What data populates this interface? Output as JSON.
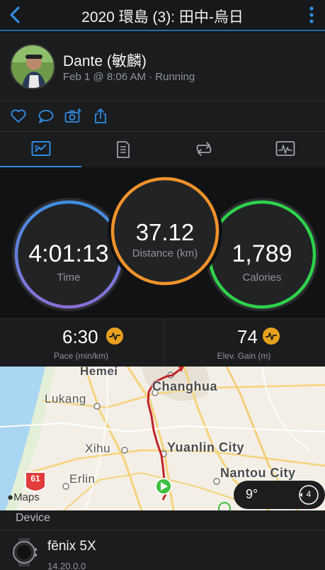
{
  "topbar": {
    "title": "2020 環島 (3): 田中-烏日"
  },
  "activity": {
    "user_name": "Dante (敏麟)",
    "meta": "Feb 1 @ 8:06 AM · Running"
  },
  "actions": [
    "heart-icon",
    "comment-icon",
    "camera-icon",
    "share-icon"
  ],
  "tabs": [
    {
      "icon": "stats-icon",
      "active": true
    },
    {
      "icon": "laps-icon",
      "active": false
    },
    {
      "icon": "repeat-icon",
      "active": false
    },
    {
      "icon": "charts-icon",
      "active": false
    }
  ],
  "stats": {
    "time": {
      "value": "4:01:13",
      "label": "Time"
    },
    "distance": {
      "value": "37.12",
      "label": "Distance (km)"
    },
    "calories": {
      "value": "1,789",
      "label": "Calories"
    }
  },
  "secondary": {
    "pace": {
      "value": "6:30",
      "label": "Pace (min/km)"
    },
    "elevation": {
      "value": "74",
      "label": "Elev. Gain (m)"
    }
  },
  "map": {
    "places": {
      "hemei": "Hemei",
      "changhua": "Changhua",
      "lukang": "Lukang",
      "xihu": "Xihu",
      "yuanlin": "Yuanlin City",
      "erlin": "Erlin",
      "nantou": "Nantou City"
    },
    "highway": "61",
    "attribution": "Maps",
    "weather_temp": "9°",
    "wind": "4"
  },
  "device": {
    "section_label": "Device",
    "name": "fēnix 5X",
    "version": "14.20.0.0"
  },
  "colors": {
    "accent": "#2f8de4",
    "time_ring": "#5b7fd6",
    "distance_ring": "#f0922b",
    "calories_ring": "#2ed24a",
    "route": "#c0232a"
  }
}
